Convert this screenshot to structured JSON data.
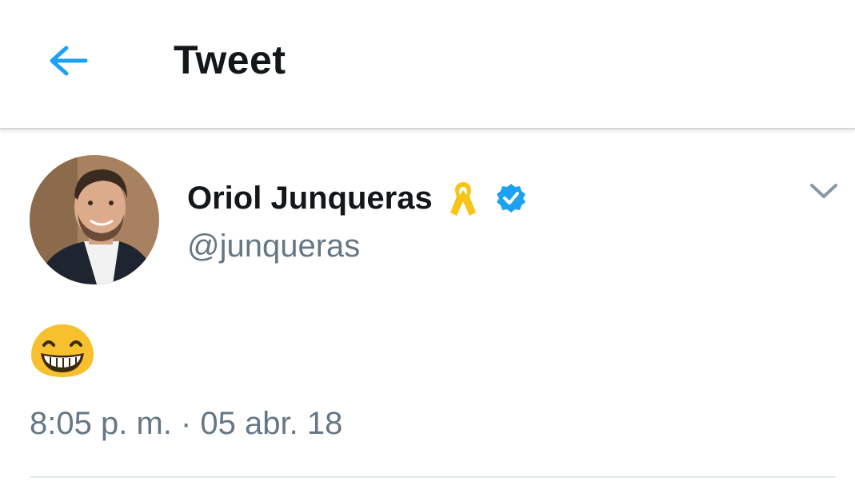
{
  "header": {
    "title": "Tweet",
    "back_icon": "arrow-left-icon"
  },
  "tweet": {
    "author": {
      "name": "Oriol Junqueras",
      "handle": "@junqueras",
      "avatar": "profile-photo",
      "badges": [
        "yellow-ribbon-icon",
        "verified-icon"
      ]
    },
    "menu_icon": "chevron-down-icon",
    "content_emoji": "grinning-face-icon",
    "timestamp": "8:05 p. m. · 05 abr. 18"
  },
  "colors": {
    "accent": "#1da1f2",
    "text_primary": "#14171a",
    "text_secondary": "#657786",
    "ribbon": "#f5c518",
    "emoji": "#f6c02f",
    "divider": "#e1e8ed"
  }
}
